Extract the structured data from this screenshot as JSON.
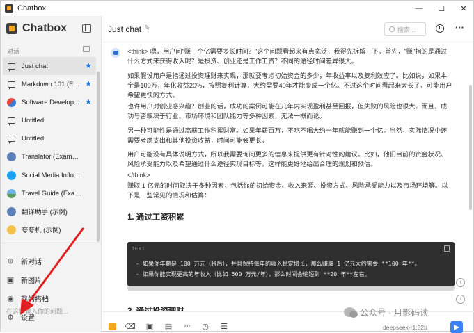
{
  "window": {
    "title": "Chatbox"
  },
  "sidebar": {
    "brand": "Chatbox",
    "section_label": "对话",
    "sessions": [
      {
        "label": "Just chat",
        "starred": true,
        "active": true,
        "icon": "chat-icon"
      },
      {
        "label": "Markdown 101 (E...",
        "starred": true,
        "icon": "chat-icon"
      },
      {
        "label": "Software Develop...",
        "starred": true,
        "icon": "developer-avatar-icon"
      },
      {
        "label": "Untitled",
        "icon": "chat-icon"
      },
      {
        "label": "Untitled",
        "icon": "chat-icon"
      },
      {
        "label": "Translator (Example)",
        "icon": "translator-avatar-icon"
      },
      {
        "label": "Social Media Influence...",
        "icon": "twitter-avatar-icon"
      },
      {
        "label": "Travel Guide (Example)",
        "icon": "travel-avatar-icon"
      },
      {
        "label": "翻译助手 (示例)",
        "icon": "translator-avatar-icon"
      },
      {
        "label": "夸夸机 (示例)",
        "icon": "praise-avatar-icon"
      }
    ],
    "bottom": [
      {
        "label": "新对话",
        "icon": "plus-circle-icon"
      },
      {
        "label": "新图片",
        "icon": "image-icon"
      },
      {
        "label": "我的搭档",
        "icon": "robot-icon"
      },
      {
        "label": "设置",
        "icon": "gear-icon"
      }
    ]
  },
  "header": {
    "title": "Just chat",
    "search_placeholder": "搜索..."
  },
  "message": {
    "think_open": "<think> 嗯，用户问\"赚一个亿需要多长时间？\"这个问题看起来有点宽泛，我得先拆解一下。首先，\"赚\"指的是通过什么方式来获得收入呢？是投资、创业还是工作工资？不同的途径时间差异很大。",
    "p2": "如果假设用户是指通过投资理财来实现，那就要考虑初始资金的多少，年收益率以及复利效应了。比如说，如果本金是100万，年化收益20%，按照复利计算，大约需要40年才能变成一个亿。不过这个时间看起来太长了，可能用户希望更快的方式。",
    "p3": "也许用户对创业感兴趣？创业的话，成功的案例可能在几年内实现盈利甚至回报，但失败的风险也很大。而且，成功与否取决于行业、市场环境和团队能力等多种因素，无法一概而论。",
    "p4": "另一种可能性是通过高薪工作积累财富。如果年薪百万，不吃不喝大约十年就能赚到一个亿。当然，实际情况中还需要考虑支出和其他投资收益，时间可能会更长。",
    "p5": "用户可能没有具体说明方式，所以我需要询问更多的信息来提供更有针对性的建议。比如，他们目前的资金状况、风险承受能力以及希望通过什么途径实现目标等。这样能更好地给出合理的规划和预估。",
    "think_close": "</think>",
    "p6": "赚取 1 亿元的时间取决于多种因素，包括你的初始资金、收入来源、投资方式、风险承受能力以及市场环境等。以下是一些常见的情况和估算：",
    "h1": "1. 通过工资积累",
    "code_tag": "TEXT",
    "code_line1": "- 如果你年薪是 100 万元（税后），并且保持每年的收入稳定增长，那么赚取 1 亿元大约需要 **100 年**。",
    "code_line2": "- 如果你能实现更高的年收入（比如 500 万元/年），那么时间会缩短到 **20 年**左右。",
    "h2": "2. 通过投资理财"
  },
  "toolbar": {
    "model_label": "deepseek-r1:32b",
    "input_placeholder": "在这里输入你的问题...",
    "icons": [
      "chatbox-icon",
      "eraser-icon",
      "image-icon",
      "folder-icon",
      "link-icon",
      "globe-icon",
      "settings-sliders-icon"
    ]
  },
  "overlay": {
    "watermark": "公众号 · 月影码读"
  },
  "colors": {
    "accent": "#3b82f6",
    "star": "#1a73e8",
    "code_bg": "#2f2f2f",
    "annotation_arrow": "#e02020"
  }
}
